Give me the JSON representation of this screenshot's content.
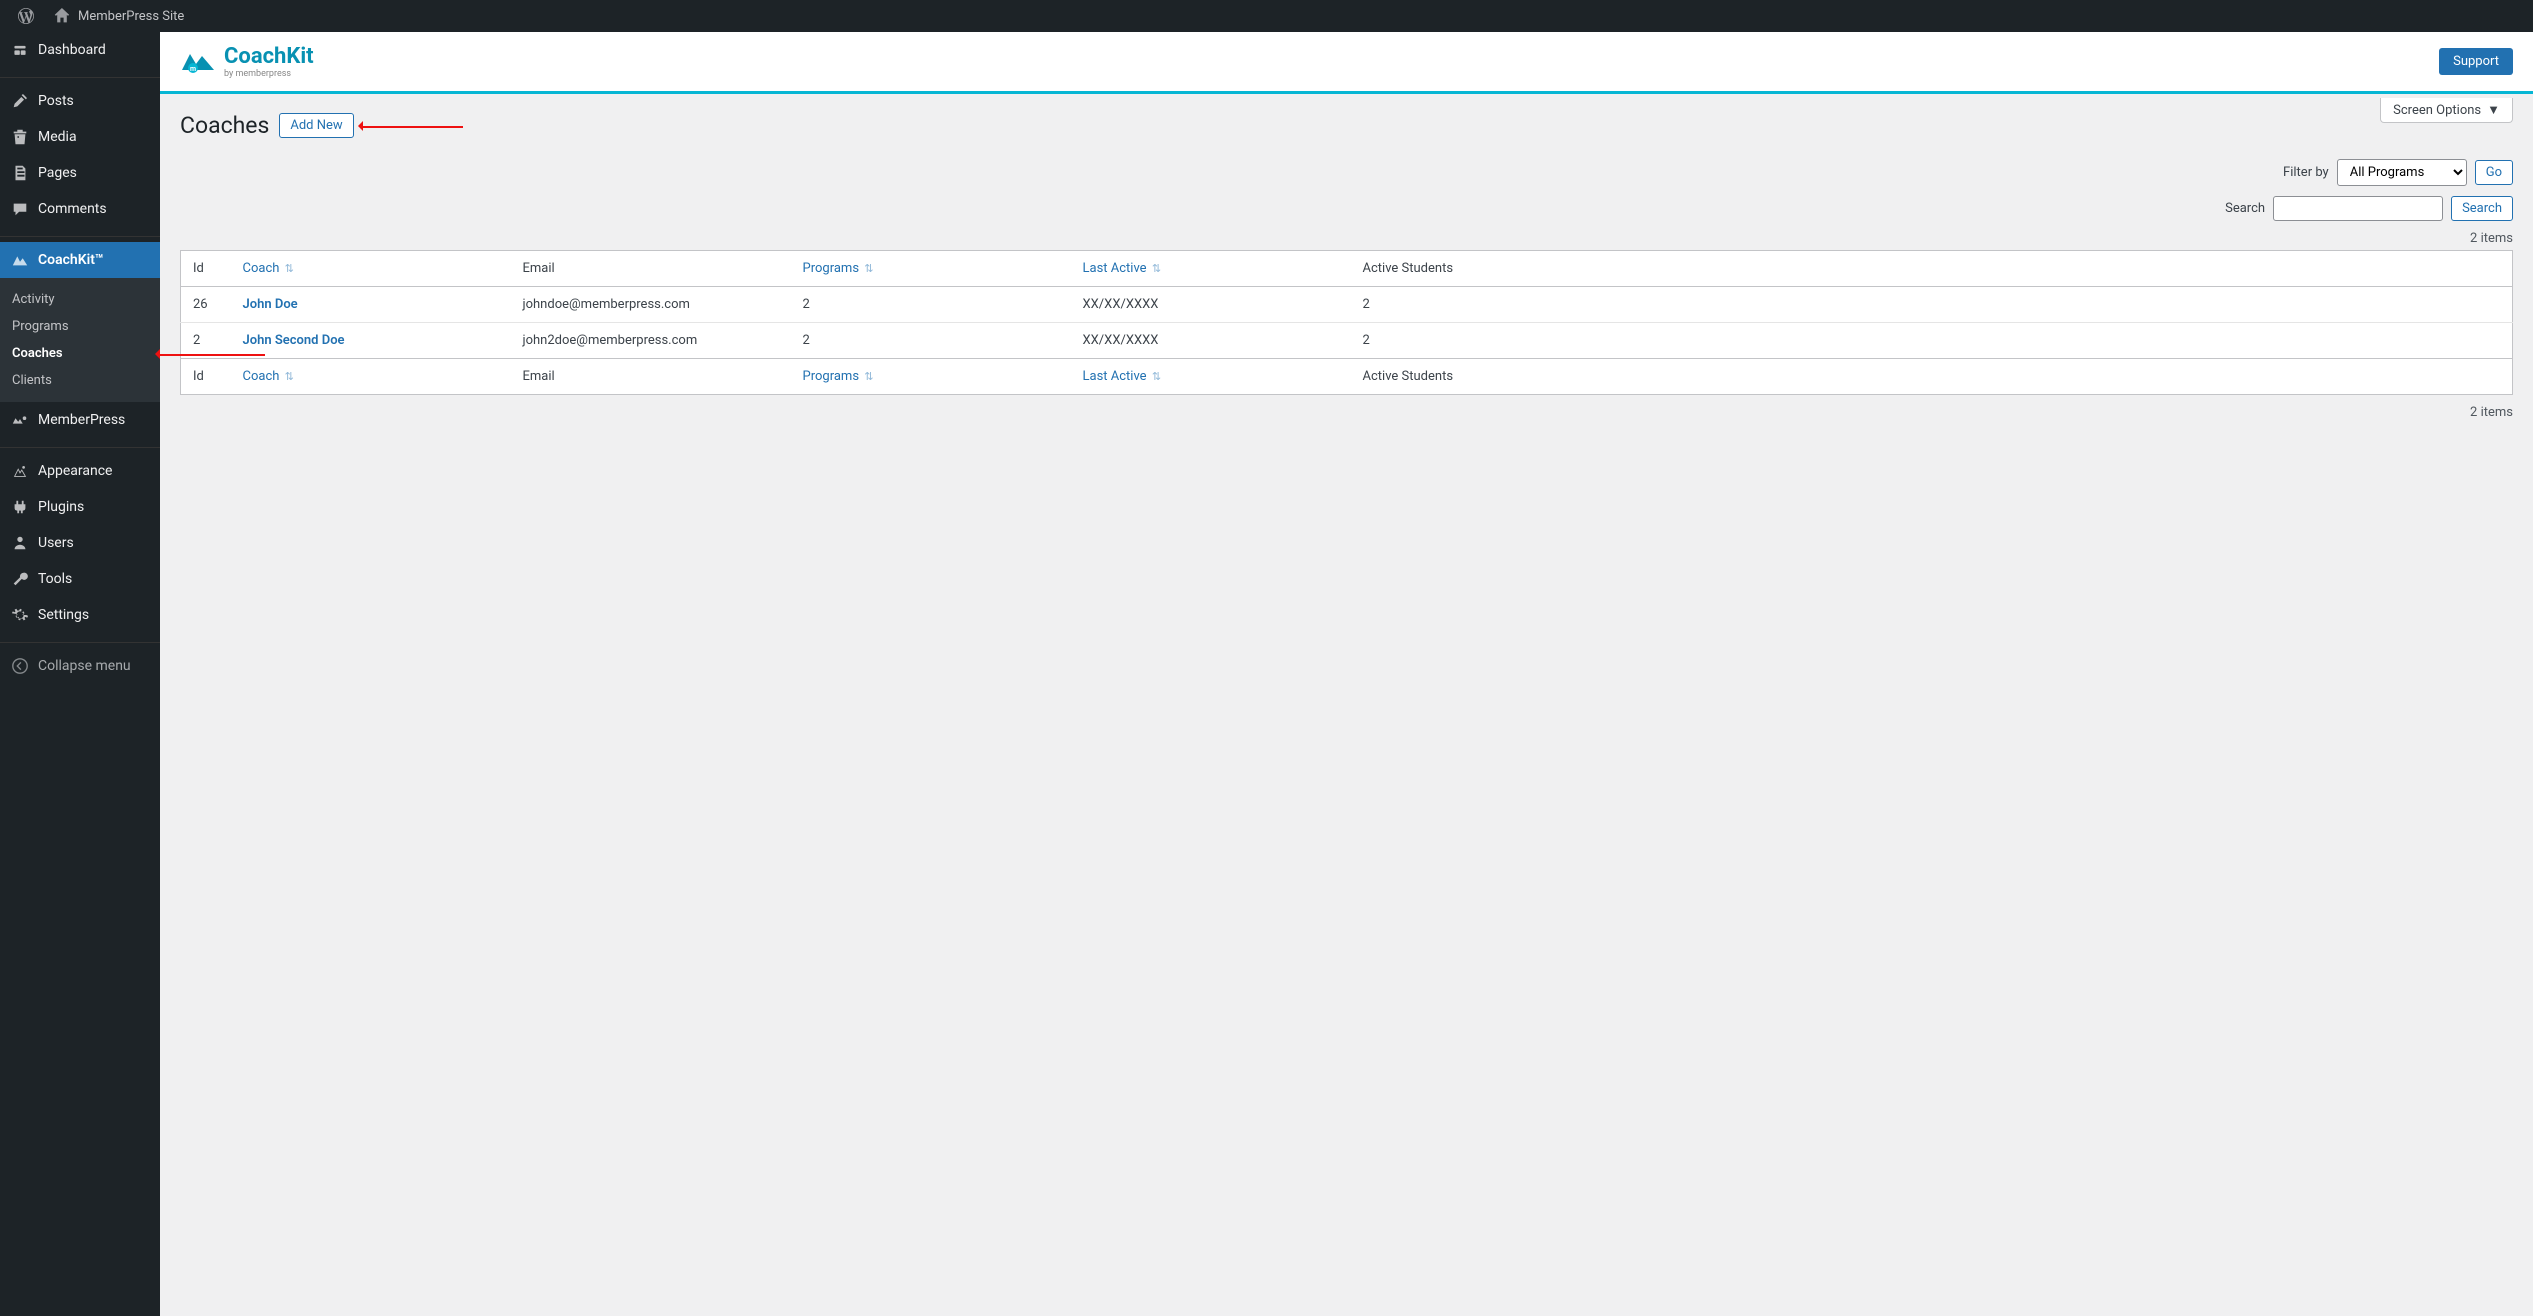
{
  "adminbar": {
    "site_name": "MemberPress Site"
  },
  "sidebar": {
    "dashboard": "Dashboard",
    "posts": "Posts",
    "media": "Media",
    "pages": "Pages",
    "comments": "Comments",
    "coachkit": "CoachKit™",
    "memberpress": "MemberPress",
    "appearance": "Appearance",
    "plugins": "Plugins",
    "users": "Users",
    "tools": "Tools",
    "settings": "Settings",
    "collapse": "Collapse menu",
    "sub": {
      "activity": "Activity",
      "programs": "Programs",
      "coaches": "Coaches",
      "clients": "Clients"
    }
  },
  "brand": {
    "name": "CoachKit",
    "sub": "by memberpress",
    "support": "Support"
  },
  "screen_options": "Screen Options",
  "page": {
    "title": "Coaches",
    "add_new": "Add New",
    "filter_label": "Filter by",
    "filter_value": "All Programs",
    "go": "Go",
    "search_label": "Search",
    "search_btn": "Search",
    "items_count": "2 items"
  },
  "table": {
    "headers": {
      "id": "Id",
      "coach": "Coach",
      "email": "Email",
      "programs": "Programs",
      "last_active": "Last Active",
      "active_students": "Active Students"
    },
    "rows": [
      {
        "id": "26",
        "coach": "John Doe",
        "email": "johndoe@memberpress.com",
        "programs": "2",
        "last_active": "XX/XX/XXXX",
        "active_students": "2"
      },
      {
        "id": "2",
        "coach": "John Second Doe",
        "email": "john2doe@memberpress.com",
        "programs": "2",
        "last_active": "XX/XX/XXXX",
        "active_students": "2"
      }
    ]
  }
}
